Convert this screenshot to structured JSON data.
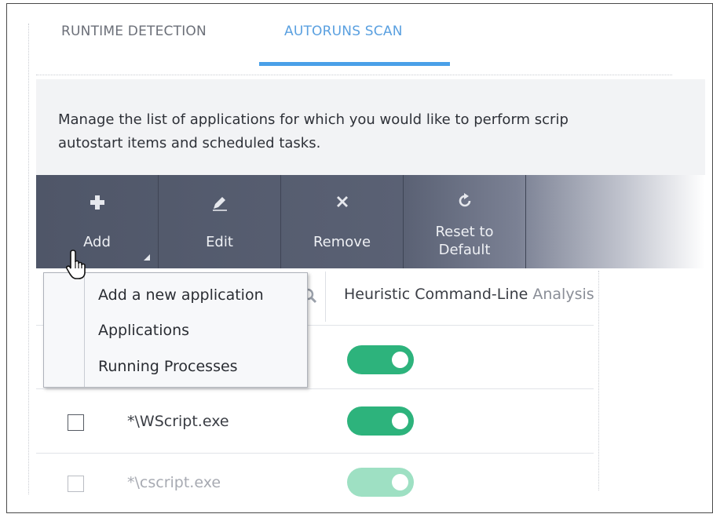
{
  "tabs": [
    {
      "label": "RUNTIME DETECTION"
    },
    {
      "label": "AUTORUNS SCAN"
    }
  ],
  "active_tab": "AUTORUNS SCAN",
  "description": {
    "line1": "Manage the list of applications for which you would like to perform scrip",
    "line2": "autostart items and scheduled tasks."
  },
  "toolbar": {
    "add_label": "Add",
    "edit_label": "Edit",
    "remove_label": "Remove",
    "reset_line1": "Reset to",
    "reset_line2": "Default",
    "icons": {
      "add": "plus-icon",
      "edit": "pencil-icon",
      "remove": "x-icon",
      "reset": "refresh-icon"
    }
  },
  "table": {
    "column_header_main": "Heuristic Command-Line",
    "column_header_fade": " Analysis",
    "rows": [
      {
        "name": "",
        "enabled": true
      },
      {
        "name": "*\\WScript.exe",
        "enabled": true
      },
      {
        "name": "*\\cscript.exe",
        "enabled": true
      }
    ]
  },
  "add_menu": {
    "items": [
      "Add a new application",
      "Applications",
      "Running Processes"
    ]
  },
  "colors": {
    "accent_tab": "#5aa0e0",
    "toggle_on": "#2db37c",
    "toolbar_bg": "#525a6c"
  }
}
